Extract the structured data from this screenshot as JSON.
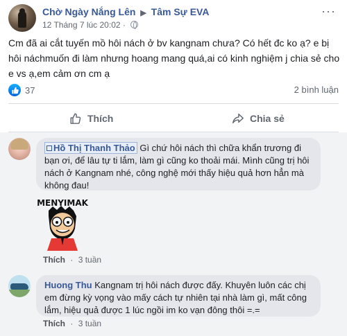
{
  "post": {
    "author": "Chờ Ngày Nắng Lên",
    "arrow": "▶",
    "group": "Tâm Sự EVA",
    "timestamp": "12 Tháng 7 lúc 20:02 ·",
    "more": "···",
    "text": "Cm đã ai cắt tuyến mồ hôi nách ở bv kangnam chưa? Có hết đc ko ạ? e bị hôi náchmuốn đi làm nhưng hoang mang quá,ai có kinh nghiệm j chia sẻ cho e vs ạ,em cảm ơn cm ạ",
    "like_count": "37",
    "comment_count": "2 bình luận"
  },
  "actions": {
    "like": "Thích",
    "share": "Chia sẻ"
  },
  "comments": [
    {
      "name": "Hồ Thị Thanh Thảo",
      "text": " Gì chứ hôi nách thì chữa khẩn trương đi bạn ơi, để lâu tự ti lắm, làm gì cũng ko thoải mái. Mình cũng trị hôi nách ở Kangnam nhé, công nghệ mới thấy hiệu quả hơn hẳn mà không đau!",
      "sticker_text": "MENYIMAK",
      "like": "Thích",
      "dot": "·",
      "time": "3 tuần"
    },
    {
      "name": "Huong Thu",
      "text": " Kangnam trị hôi nách được đấy. Khuyên luôn các chị em đừng kỳ vọng vào mấy cách tự nhiên tại nhà làm gì, mất công lắm, hiệu quả được 1 lúc ngồi im ko vạn đông thôi =.=",
      "like": "Thích",
      "dot": "·",
      "time": "3 tuần"
    }
  ],
  "colors": {
    "link": "#385898",
    "like_blue": "#1877f2",
    "bubble": "#e4e6eb"
  }
}
